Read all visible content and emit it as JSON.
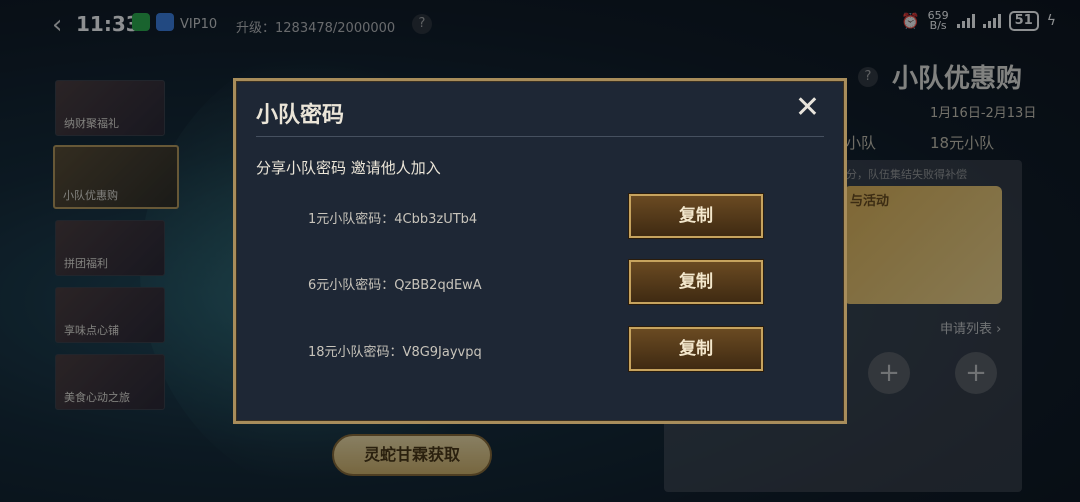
{
  "status": {
    "time": "11:33",
    "vip": "VIP10",
    "upgrade": "升级：1283478/2000000",
    "net_speed_top": "659",
    "net_speed_bottom": "B/s",
    "battery": "51"
  },
  "sidebar": {
    "items": [
      {
        "label": "纳财聚福礼"
      },
      {
        "label": "小队优惠购"
      },
      {
        "label": "拼团福利"
      },
      {
        "label": "享味点心铺"
      },
      {
        "label": "美食心动之旅"
      }
    ]
  },
  "right_panel": {
    "title": "小队优惠购",
    "date": "1月16日-2月13日",
    "tab_left": "小队",
    "tab_right": "18元小队",
    "hint": "分，队伍集结失败得补偿",
    "banner_text": "与活动",
    "apply_list": "申请列表 ›"
  },
  "bottom_button": "灵蛇甘霖获取",
  "modal": {
    "title": "小队密码",
    "subtitle": "分享小队密码 邀请他人加入",
    "rows": [
      {
        "label": "1元小队密码：",
        "code": "4Cbb3zUTb4",
        "button": "复制"
      },
      {
        "label": "6元小队密码：",
        "code": "QzBB2qdEwA",
        "button": "复制"
      },
      {
        "label": "18元小队密码：",
        "code": "V8G9Jayvpq",
        "button": "复制"
      }
    ]
  },
  "colors": {
    "accent_gold": "#a88d5b",
    "modal_bg": "#1e2735",
    "copy_button": "#5a3c1a"
  }
}
